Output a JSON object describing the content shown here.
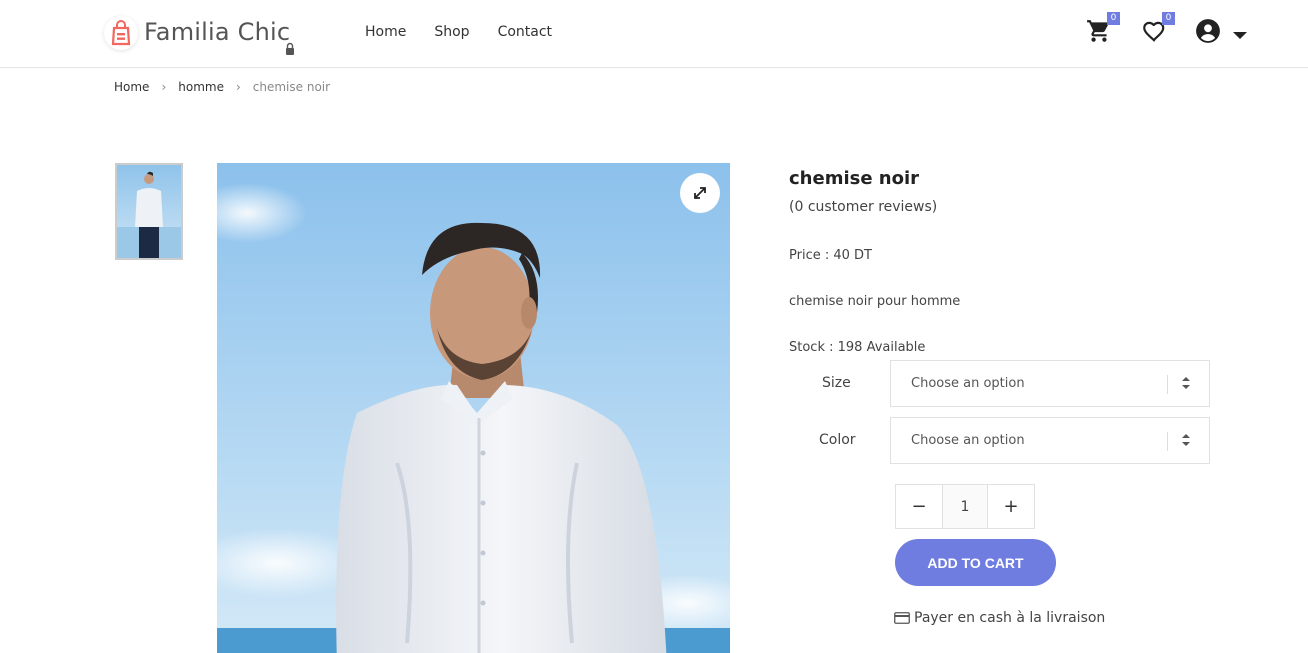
{
  "brand": {
    "name": "Familia Chic",
    "accent": "#6f7ce0",
    "logo_color": "#f0685f"
  },
  "nav": {
    "items": [
      "Home",
      "Shop",
      "Contact"
    ]
  },
  "header_icons": {
    "cart": {
      "icon": "cart-icon",
      "count": "0"
    },
    "wishlist": {
      "icon": "heart-icon",
      "count": "0"
    },
    "account": {
      "icon": "user-icon"
    },
    "menu": {
      "icon": "caret-down-icon"
    }
  },
  "breadcrumb": {
    "items": [
      "Home",
      "homme",
      "chemise noir"
    ],
    "separator": "›"
  },
  "product": {
    "title": "chemise noir",
    "reviews": "(0 customer reviews)",
    "price": "Price : 40 DT",
    "description": "chemise noir pour homme",
    "stock": "Stock : 198 Available",
    "options": [
      {
        "label": "Size",
        "placeholder": "Choose an option"
      },
      {
        "label": "Color",
        "placeholder": "Choose an option"
      }
    ],
    "quantity": {
      "minus": "−",
      "value": "1",
      "plus": "+"
    },
    "add_to_cart": "ADD TO CART",
    "payment_note": "Payer en cash à la livraison"
  }
}
